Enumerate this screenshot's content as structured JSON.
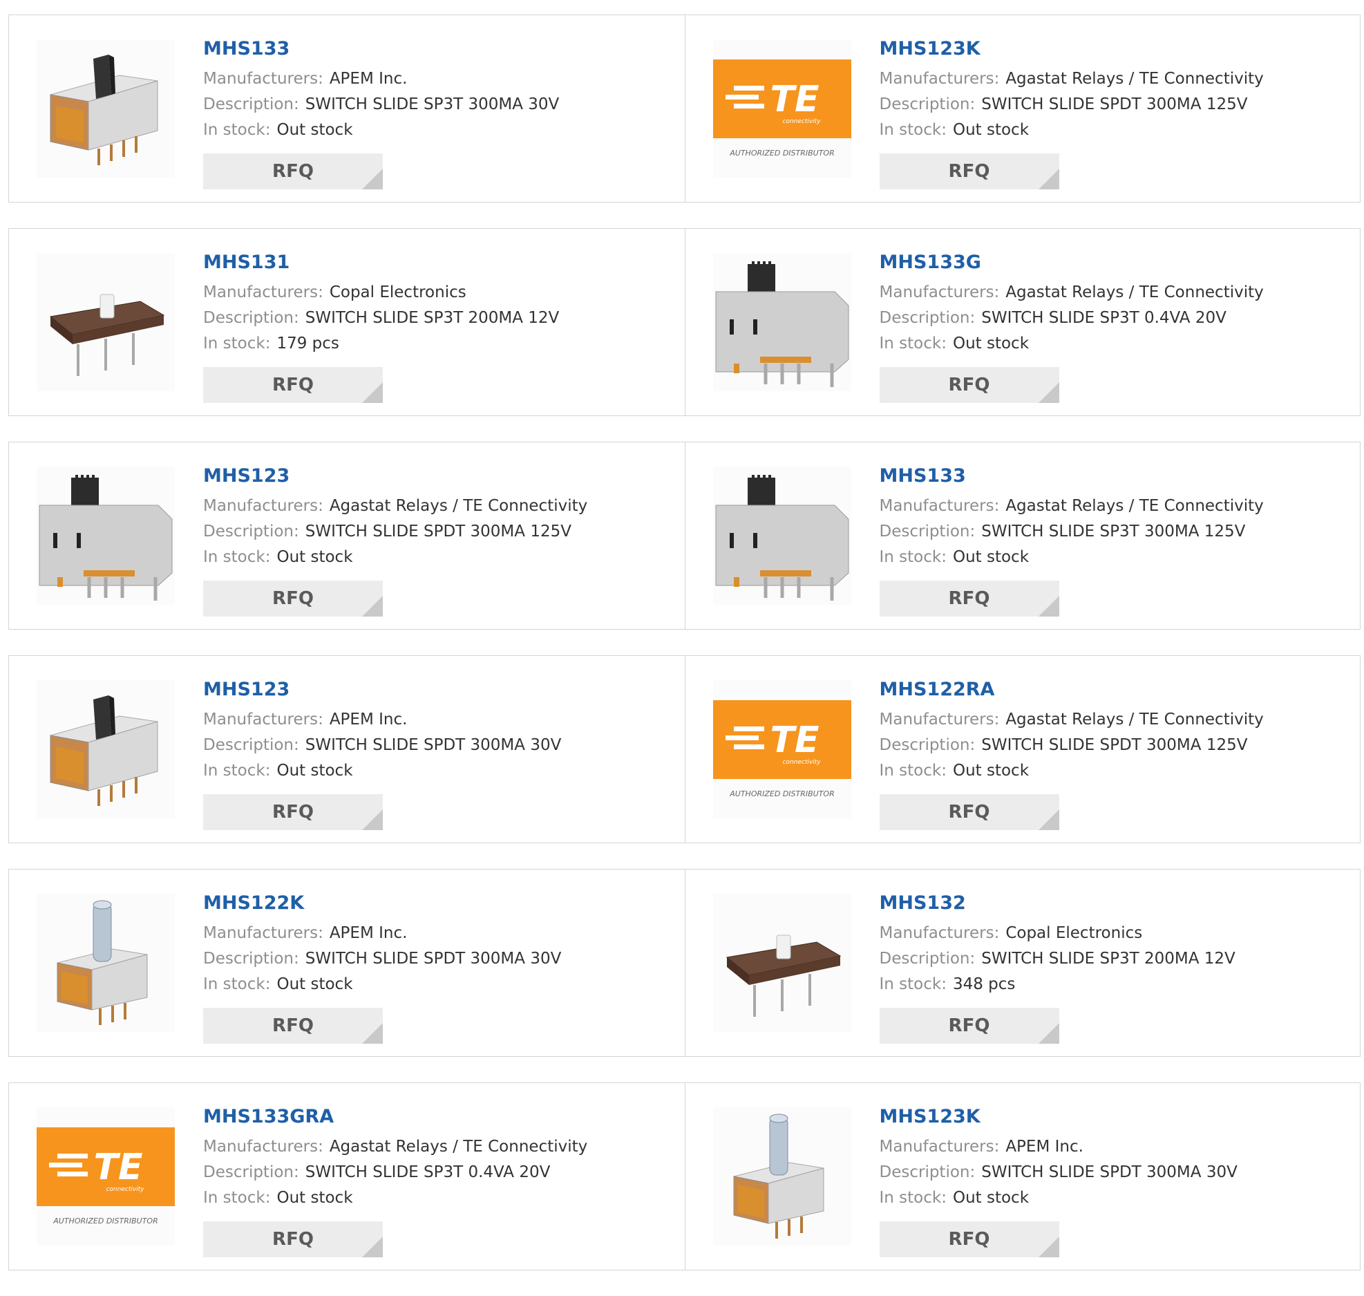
{
  "theme": {
    "part_link_color": "#1f5fa7",
    "label_color": "#8e8e8e",
    "border_color": "#d4d4d4",
    "button_bg": "#ececec",
    "te_orange": "#f7941d"
  },
  "labels": {
    "manufacturer": "Manufacturers:",
    "description": "Description:",
    "stock": "In stock:",
    "rfq": "RFQ"
  },
  "logo": {
    "te_text": "TE",
    "te_sub": "connectivity",
    "authorized": "AUTHORIZED DISTRIBUTOR"
  },
  "rows": [
    [
      {
        "part": "MHS133",
        "manufacturer": "APEM Inc.",
        "description": "SWITCH SLIDE SP3T 300MA 30V",
        "stock": "Out stock",
        "image": "apem-switch-icon"
      },
      {
        "part": "MHS123K",
        "manufacturer": "Agastat Relays / TE Connectivity",
        "description": "SWITCH SLIDE SPDT 300MA 125V",
        "stock": "Out stock",
        "image": "te-logo"
      }
    ],
    [
      {
        "part": "MHS131",
        "manufacturer": "Copal Electronics",
        "description": "SWITCH SLIDE SP3T 200MA 12V",
        "stock": "179 pcs",
        "image": "copal-switch-icon"
      },
      {
        "part": "MHS133G",
        "manufacturer": "Agastat Relays / TE Connectivity",
        "description": "SWITCH SLIDE SP3T 0.4VA 20V",
        "stock": "Out stock",
        "image": "te-switch-icon"
      }
    ],
    [
      {
        "part": "MHS123",
        "manufacturer": "Agastat Relays / TE Connectivity",
        "description": "SWITCH SLIDE SPDT 300MA 125V",
        "stock": "Out stock",
        "image": "te-switch-icon"
      },
      {
        "part": "MHS133",
        "manufacturer": "Agastat Relays / TE Connectivity",
        "description": "SWITCH SLIDE SP3T 300MA 125V",
        "stock": "Out stock",
        "image": "te-switch-icon"
      }
    ],
    [
      {
        "part": "MHS123",
        "manufacturer": "APEM Inc.",
        "description": "SWITCH SLIDE SPDT 300MA 30V",
        "stock": "Out stock",
        "image": "apem-switch-icon"
      },
      {
        "part": "MHS122RA",
        "manufacturer": "Agastat Relays / TE Connectivity",
        "description": "SWITCH SLIDE SPDT 300MA 125V",
        "stock": "Out stock",
        "image": "te-logo"
      }
    ],
    [
      {
        "part": "MHS122K",
        "manufacturer": "APEM Inc.",
        "description": "SWITCH SLIDE SPDT 300MA 30V",
        "stock": "Out stock",
        "image": "apem-tall-switch-icon"
      },
      {
        "part": "MHS132",
        "manufacturer": "Copal Electronics",
        "description": "SWITCH SLIDE SP3T 200MA 12V",
        "stock": "348 pcs",
        "image": "copal-switch-icon"
      }
    ],
    [
      {
        "part": "MHS133GRA",
        "manufacturer": "Agastat Relays / TE Connectivity",
        "description": "SWITCH SLIDE SP3T 0.4VA 20V",
        "stock": "Out stock",
        "image": "te-logo"
      },
      {
        "part": "MHS123K",
        "manufacturer": "APEM Inc.",
        "description": "SWITCH SLIDE SPDT 300MA 30V",
        "stock": "Out stock",
        "image": "apem-tall-switch-icon"
      }
    ]
  ]
}
